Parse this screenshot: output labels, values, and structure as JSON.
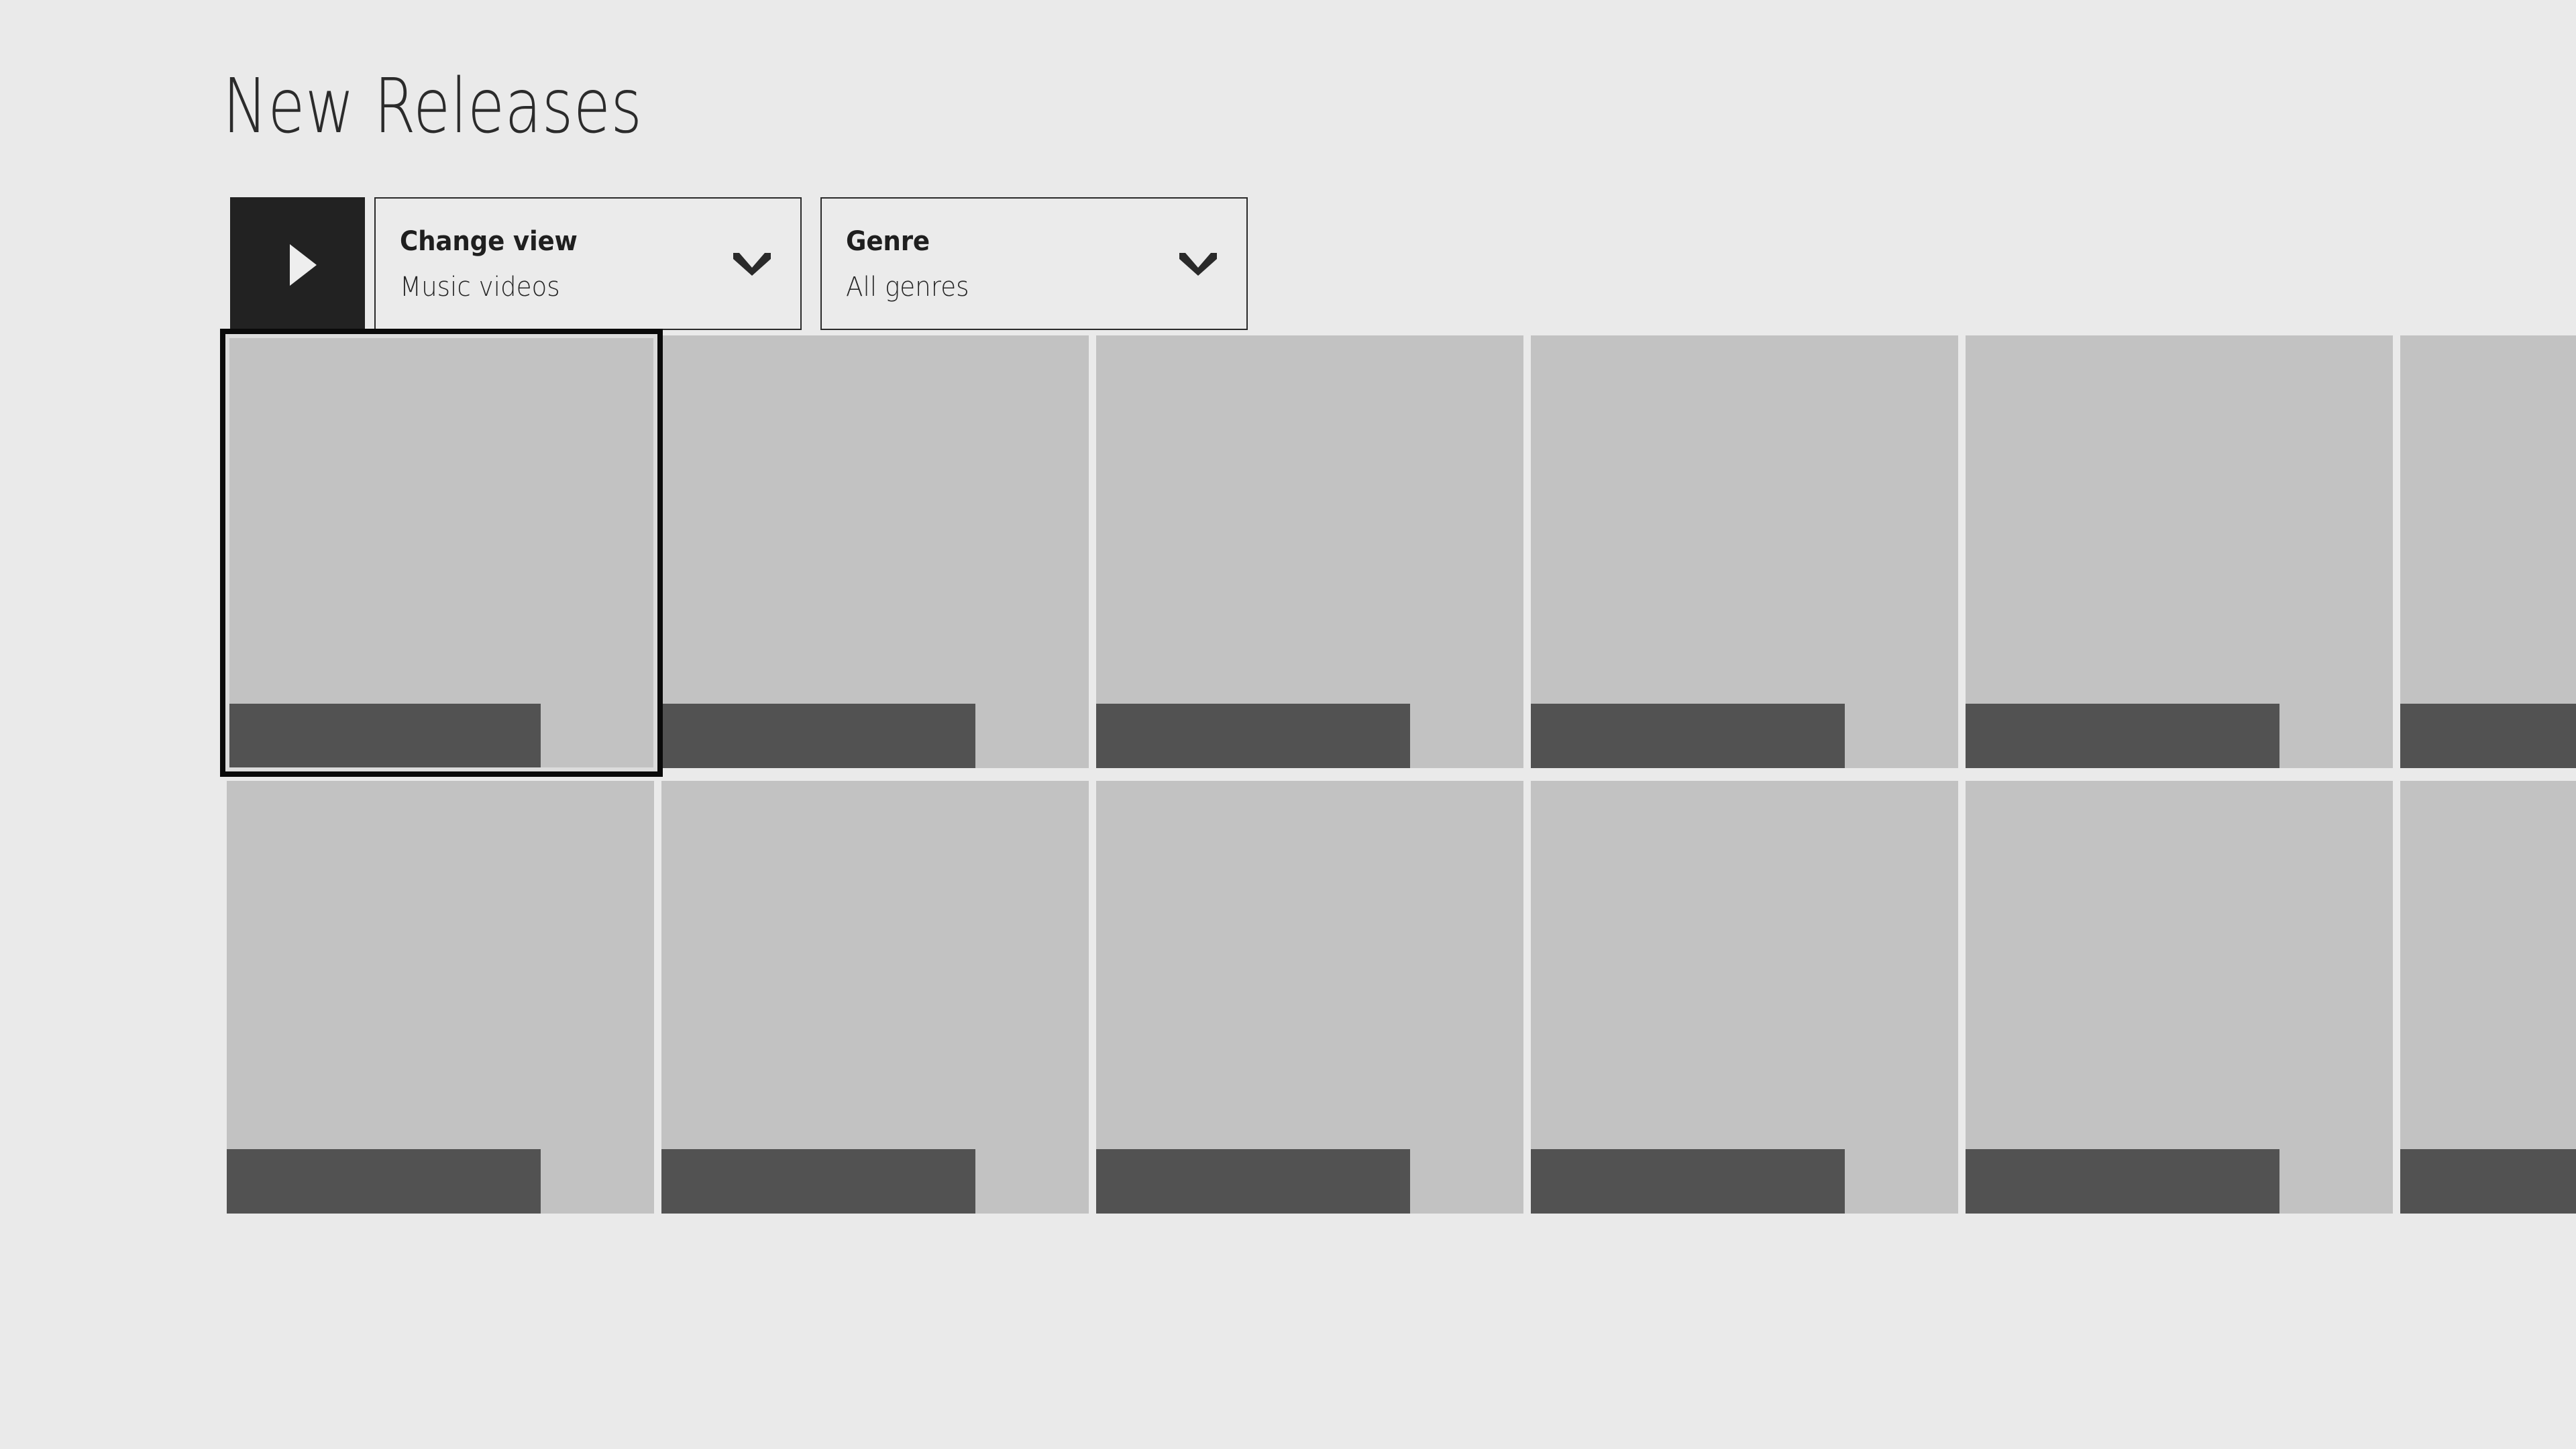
{
  "page": {
    "title": "New Releases",
    "background_color": "#eaeaea"
  },
  "command_bar": {
    "play_button": {
      "name": "play-button",
      "icon": "play-triangle-icon",
      "background_color": "#222222"
    },
    "dropdowns": [
      {
        "id": "change-view",
        "label": "Change view",
        "value": "Music videos",
        "icon": "chevron-down-icon"
      },
      {
        "id": "genre",
        "label": "Genre",
        "value": "All genres",
        "icon": "chevron-down-icon"
      }
    ]
  },
  "grid": {
    "tile_color": "#c2c2c2",
    "tile_bar_color": "#525252",
    "selection_border_color": "#0a0a0a",
    "columns": 6,
    "rows": [
      {
        "index": 0,
        "tiles": [
          {
            "index": 0,
            "selected": true
          },
          {
            "index": 1,
            "selected": false
          },
          {
            "index": 2,
            "selected": false
          },
          {
            "index": 3,
            "selected": false
          },
          {
            "index": 4,
            "selected": false
          },
          {
            "index": 5,
            "selected": false
          }
        ]
      },
      {
        "index": 1,
        "tiles": [
          {
            "index": 0,
            "selected": false
          },
          {
            "index": 1,
            "selected": false
          },
          {
            "index": 2,
            "selected": false
          },
          {
            "index": 3,
            "selected": false
          },
          {
            "index": 4,
            "selected": false
          },
          {
            "index": 5,
            "selected": false
          }
        ]
      }
    ]
  }
}
